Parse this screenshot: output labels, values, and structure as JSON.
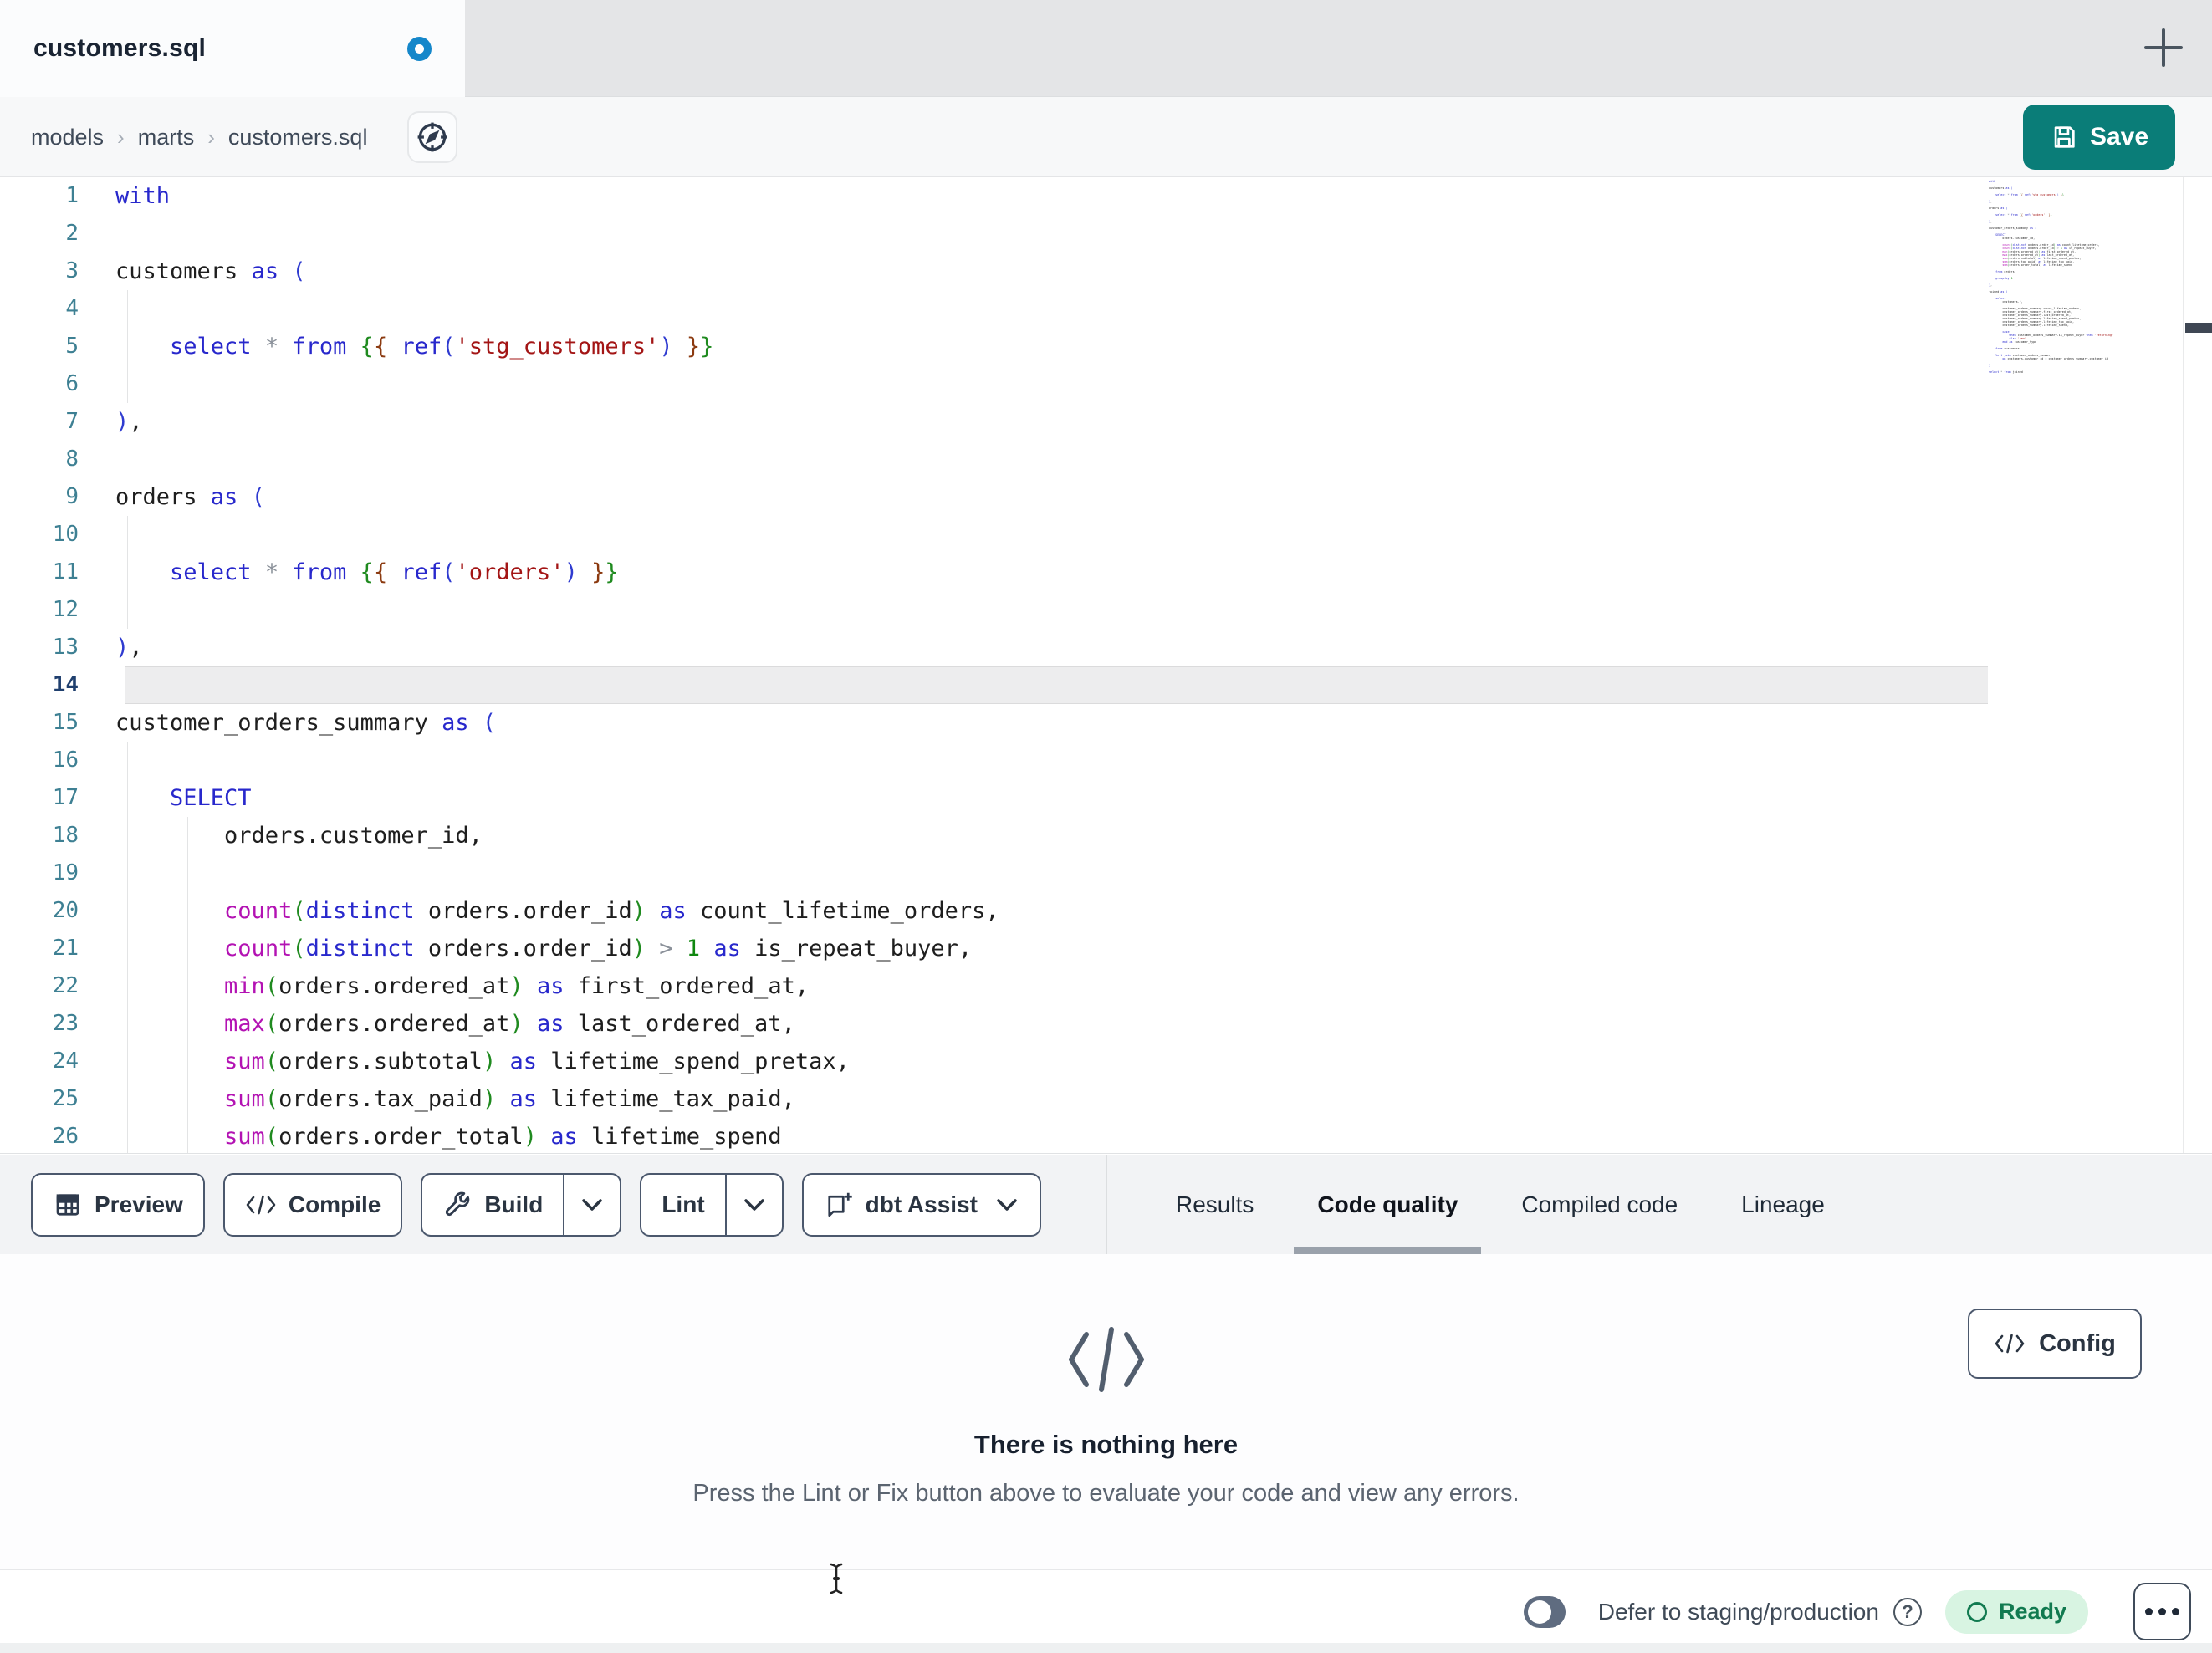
{
  "tab_bar": {
    "tab_title": "customers.sql",
    "unsaved": true,
    "new_tab_label": "+"
  },
  "breadcrumb": {
    "items": [
      "models",
      "marts",
      "customers.sql"
    ],
    "separator": "›"
  },
  "save_button": {
    "label": "Save"
  },
  "colors": {
    "accent-teal": "#0a7d78",
    "dot-blue": "#1587ca",
    "ready-bg": "#d8f4e2",
    "ready-fg": "#117a50"
  },
  "token_colors": {
    "kw": "#2828cc",
    "fn": "#b312b3",
    "str": "#a31515",
    "num": "#0f870f",
    "op": "#8a9099",
    "b1": "#2f3bd0",
    "b2": "#1f8a1f",
    "b3": "#8b3a10",
    "pl": "#1e1e1e"
  },
  "editor": {
    "active_line": 14,
    "line_count": 26,
    "lines": [
      [
        [
          "kw",
          "with"
        ]
      ],
      [],
      [
        [
          "pl",
          "customers "
        ],
        [
          "kw",
          "as"
        ],
        [
          "pl",
          " "
        ],
        [
          "b1",
          "("
        ]
      ],
      [],
      [
        [
          "pl",
          "    "
        ],
        [
          "kw",
          "select"
        ],
        [
          "pl",
          " "
        ],
        [
          "op",
          "*"
        ],
        [
          "pl",
          " "
        ],
        [
          "kw",
          "from"
        ],
        [
          "pl",
          " "
        ],
        [
          "b2",
          "{"
        ],
        [
          "b3",
          "{"
        ],
        [
          "pl",
          " "
        ],
        [
          "kw",
          "ref"
        ],
        [
          "b1",
          "("
        ],
        [
          "str",
          "'stg_customers'"
        ],
        [
          "b1",
          ")"
        ],
        [
          "pl",
          " "
        ],
        [
          "b3",
          "}"
        ],
        [
          "b2",
          "}"
        ]
      ],
      [],
      [
        [
          "b1",
          ")"
        ],
        [
          "pl",
          ","
        ]
      ],
      [],
      [
        [
          "pl",
          "orders "
        ],
        [
          "kw",
          "as"
        ],
        [
          "pl",
          " "
        ],
        [
          "b1",
          "("
        ]
      ],
      [],
      [
        [
          "pl",
          "    "
        ],
        [
          "kw",
          "select"
        ],
        [
          "pl",
          " "
        ],
        [
          "op",
          "*"
        ],
        [
          "pl",
          " "
        ],
        [
          "kw",
          "from"
        ],
        [
          "pl",
          " "
        ],
        [
          "b2",
          "{"
        ],
        [
          "b3",
          "{"
        ],
        [
          "pl",
          " "
        ],
        [
          "kw",
          "ref"
        ],
        [
          "b1",
          "("
        ],
        [
          "str",
          "'orders'"
        ],
        [
          "b1",
          ")"
        ],
        [
          "pl",
          " "
        ],
        [
          "b3",
          "}"
        ],
        [
          "b2",
          "}"
        ]
      ],
      [],
      [
        [
          "b1",
          ")"
        ],
        [
          "pl",
          ","
        ]
      ],
      [],
      [
        [
          "pl",
          "customer_orders_summary "
        ],
        [
          "kw",
          "as"
        ],
        [
          "pl",
          " "
        ],
        [
          "b1",
          "("
        ]
      ],
      [],
      [
        [
          "pl",
          "    "
        ],
        [
          "kw",
          "SELECT"
        ]
      ],
      [
        [
          "pl",
          "        orders.customer_id,"
        ]
      ],
      [],
      [
        [
          "pl",
          "        "
        ],
        [
          "fn",
          "count"
        ],
        [
          "b2",
          "("
        ],
        [
          "kw",
          "distinct"
        ],
        [
          "pl",
          " orders.order_id"
        ],
        [
          "b2",
          ")"
        ],
        [
          "pl",
          " "
        ],
        [
          "kw",
          "as"
        ],
        [
          "pl",
          " count_lifetime_orders,"
        ]
      ],
      [
        [
          "pl",
          "        "
        ],
        [
          "fn",
          "count"
        ],
        [
          "b2",
          "("
        ],
        [
          "kw",
          "distinct"
        ],
        [
          "pl",
          " orders.order_id"
        ],
        [
          "b2",
          ")"
        ],
        [
          "pl",
          " "
        ],
        [
          "op",
          ">"
        ],
        [
          "pl",
          " "
        ],
        [
          "num",
          "1"
        ],
        [
          "pl",
          " "
        ],
        [
          "kw",
          "as"
        ],
        [
          "pl",
          " is_repeat_buyer,"
        ]
      ],
      [
        [
          "pl",
          "        "
        ],
        [
          "fn",
          "min"
        ],
        [
          "b2",
          "("
        ],
        [
          "pl",
          "orders.ordered_at"
        ],
        [
          "b2",
          ")"
        ],
        [
          "pl",
          " "
        ],
        [
          "kw",
          "as"
        ],
        [
          "pl",
          " first_ordered_at,"
        ]
      ],
      [
        [
          "pl",
          "        "
        ],
        [
          "fn",
          "max"
        ],
        [
          "b2",
          "("
        ],
        [
          "pl",
          "orders.ordered_at"
        ],
        [
          "b2",
          ")"
        ],
        [
          "pl",
          " "
        ],
        [
          "kw",
          "as"
        ],
        [
          "pl",
          " last_ordered_at,"
        ]
      ],
      [
        [
          "pl",
          "        "
        ],
        [
          "fn",
          "sum"
        ],
        [
          "b2",
          "("
        ],
        [
          "pl",
          "orders.subtotal"
        ],
        [
          "b2",
          ")"
        ],
        [
          "pl",
          " "
        ],
        [
          "kw",
          "as"
        ],
        [
          "pl",
          " lifetime_spend_pretax,"
        ]
      ],
      [
        [
          "pl",
          "        "
        ],
        [
          "fn",
          "sum"
        ],
        [
          "b2",
          "("
        ],
        [
          "pl",
          "orders.tax_paid"
        ],
        [
          "b2",
          ")"
        ],
        [
          "pl",
          " "
        ],
        [
          "kw",
          "as"
        ],
        [
          "pl",
          " lifetime_tax_paid,"
        ]
      ],
      [
        [
          "pl",
          "        "
        ],
        [
          "fn",
          "sum"
        ],
        [
          "b2",
          "("
        ],
        [
          "pl",
          "orders.order_total"
        ],
        [
          "b2",
          ")"
        ],
        [
          "pl",
          " "
        ],
        [
          "kw",
          "as"
        ],
        [
          "pl",
          " lifetime_spend"
        ]
      ]
    ],
    "minimap_extra_lines": [
      [],
      [
        [
          "pl",
          "    "
        ],
        [
          "kw",
          "from"
        ],
        [
          "pl",
          " orders"
        ]
      ],
      [],
      [
        [
          "pl",
          "    "
        ],
        [
          "kw",
          "group by"
        ],
        [
          "pl",
          " "
        ],
        [
          "num",
          "1"
        ]
      ],
      [],
      [
        [
          "b1",
          ")"
        ],
        [
          "pl",
          ","
        ]
      ],
      [],
      [
        [
          "pl",
          "joined "
        ],
        [
          "kw",
          "as"
        ],
        [
          "pl",
          " "
        ],
        [
          "b1",
          "("
        ]
      ],
      [],
      [
        [
          "pl",
          "    "
        ],
        [
          "kw",
          "select"
        ]
      ],
      [
        [
          "pl",
          "        customers."
        ],
        [
          "op",
          "*"
        ],
        [
          "pl",
          ","
        ]
      ],
      [],
      [
        [
          "pl",
          "        customer_orders_summary.count_lifetime_orders,"
        ]
      ],
      [
        [
          "pl",
          "        customer_orders_summary.first_ordered_at,"
        ]
      ],
      [
        [
          "pl",
          "        customer_orders_summary.last_ordered_at,"
        ]
      ],
      [
        [
          "pl",
          "        customer_orders_summary.lifetime_spend_pretax,"
        ]
      ],
      [
        [
          "pl",
          "        customer_orders_summary.lifetime_tax_paid,"
        ]
      ],
      [
        [
          "pl",
          "        customer_orders_summary.lifetime_spend,"
        ]
      ],
      [],
      [
        [
          "pl",
          "        "
        ],
        [
          "kw",
          "case"
        ]
      ],
      [
        [
          "pl",
          "            "
        ],
        [
          "kw",
          "when"
        ],
        [
          "pl",
          " customer_orders_summary.is_repeat_buyer "
        ],
        [
          "kw",
          "then"
        ],
        [
          "pl",
          " "
        ],
        [
          "str",
          "'returning'"
        ]
      ],
      [
        [
          "pl",
          "            "
        ],
        [
          "kw",
          "else"
        ],
        [
          "pl",
          " "
        ],
        [
          "str",
          "'new'"
        ]
      ],
      [
        [
          "pl",
          "        "
        ],
        [
          "kw",
          "end"
        ],
        [
          "pl",
          " "
        ],
        [
          "kw",
          "as"
        ],
        [
          "pl",
          " customer_type"
        ]
      ],
      [],
      [
        [
          "pl",
          "    "
        ],
        [
          "kw",
          "from"
        ],
        [
          "pl",
          " customers"
        ]
      ],
      [],
      [
        [
          "pl",
          "    "
        ],
        [
          "kw",
          "left join"
        ],
        [
          "pl",
          " customer_orders_summary"
        ]
      ],
      [
        [
          "pl",
          "        "
        ],
        [
          "kw",
          "on"
        ],
        [
          "pl",
          " customers.customer_id "
        ],
        [
          "op",
          "="
        ],
        [
          "pl",
          " customer_orders_summary.customer_id"
        ]
      ],
      [],
      [
        [
          "b1",
          ")"
        ]
      ],
      [],
      [
        [
          "kw",
          "select"
        ],
        [
          "pl",
          " "
        ],
        [
          "op",
          "*"
        ],
        [
          "pl",
          " "
        ],
        [
          "kw",
          "from"
        ],
        [
          "pl",
          " joined"
        ]
      ]
    ]
  },
  "toolbar": {
    "buttons": [
      {
        "name": "preview",
        "label": "Preview",
        "icon": "table-icon"
      },
      {
        "name": "compile",
        "label": "Compile",
        "icon": "code-icon"
      },
      {
        "name": "build",
        "label": "Build",
        "icon": "wrench-icon",
        "split_chevron": true
      },
      {
        "name": "lint",
        "label": "Lint",
        "split_chevron": true
      },
      {
        "name": "dbt-assist",
        "label": "dbt Assist",
        "icon": "assist-icon",
        "inline_chevron": true
      }
    ]
  },
  "result_tabs": [
    {
      "label": "Results",
      "active": false
    },
    {
      "label": "Code quality",
      "active": true
    },
    {
      "label": "Compiled code",
      "active": false
    },
    {
      "label": "Lineage",
      "active": false
    }
  ],
  "panel": {
    "config_label": "Config",
    "empty_title": "There is nothing here",
    "empty_subtitle": "Press the Lint or Fix button above to evaluate your code and view any errors."
  },
  "status_bar": {
    "defer_label": "Defer to staging/production",
    "defer_toggle_on": false,
    "ready_label": "Ready"
  }
}
